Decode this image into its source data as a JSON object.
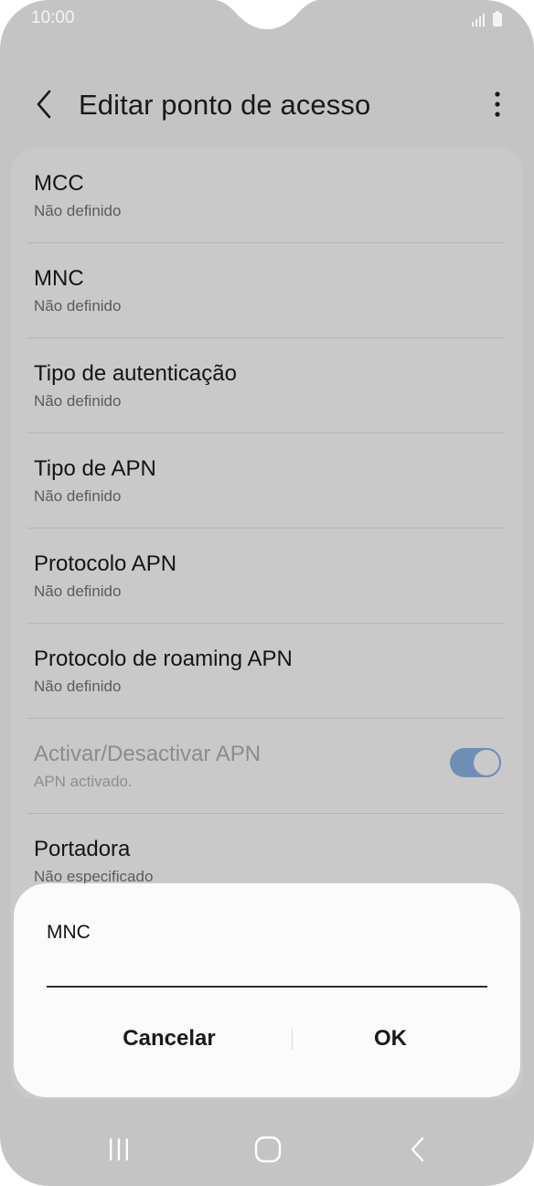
{
  "status_bar": {
    "time": "10:00"
  },
  "header": {
    "title": "Editar ponto de acesso"
  },
  "settings": [
    {
      "title": "MCC",
      "subtitle": "Não definido"
    },
    {
      "title": "MNC",
      "subtitle": "Não definido"
    },
    {
      "title": "Tipo de autenticação",
      "subtitle": "Não definido"
    },
    {
      "title": "Tipo de APN",
      "subtitle": "Não definido"
    },
    {
      "title": "Protocolo APN",
      "subtitle": "Não definido"
    },
    {
      "title": "Protocolo de roaming APN",
      "subtitle": "Não definido"
    },
    {
      "title": "Activar/Desactivar APN",
      "subtitle": "APN activado.",
      "toggle_on": true
    },
    {
      "title": "Portadora",
      "subtitle": "Não especificado"
    }
  ],
  "dialog": {
    "title": "MNC",
    "input_value": "",
    "cancel_label": "Cancelar",
    "ok_label": "OK"
  },
  "colors": {
    "accent": "#6f8fb4",
    "background": "#c4c4c4",
    "dialog_background": "#fbfbfb"
  },
  "icons": {
    "back": "chevron-left-icon",
    "more": "more-vertical-icon",
    "nav_recents": "recents-icon",
    "nav_home": "home-icon",
    "nav_back": "back-nav-icon"
  }
}
